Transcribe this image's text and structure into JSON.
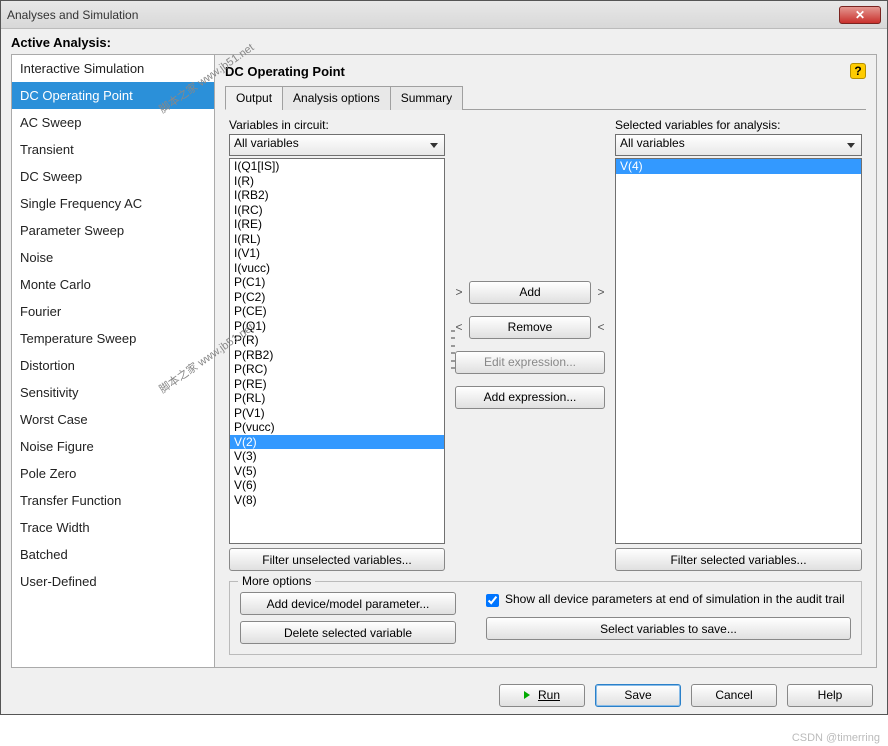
{
  "window": {
    "title": "Analyses and Simulation",
    "close": "✕"
  },
  "header": "Active Analysis:",
  "sidebar": {
    "items": [
      "Interactive Simulation",
      "DC Operating Point",
      "AC Sweep",
      "Transient",
      "DC Sweep",
      "Single Frequency AC",
      "Parameter Sweep",
      "Noise",
      "Monte Carlo",
      "Fourier",
      "Temperature Sweep",
      "Distortion",
      "Sensitivity",
      "Worst Case",
      "Noise Figure",
      "Pole Zero",
      "Transfer Function",
      "Trace Width",
      "Batched",
      "User-Defined"
    ],
    "selected_index": 1
  },
  "main": {
    "title": "DC Operating Point",
    "help": "?",
    "tabs": [
      "Output",
      "Analysis options",
      "Summary"
    ],
    "active_tab": 0,
    "left": {
      "label": "Variables in circuit:",
      "combo": "All variables",
      "items": [
        "I(Q1[IS])",
        "I(R)",
        "I(RB2)",
        "I(RC)",
        "I(RE)",
        "I(RL)",
        "I(V1)",
        "I(vucc)",
        "P(C1)",
        "P(C2)",
        "P(CE)",
        "P(Q1)",
        "P(R)",
        "P(RB2)",
        "P(RC)",
        "P(RE)",
        "P(RL)",
        "P(V1)",
        "P(vucc)",
        "V(2)",
        "V(3)",
        "V(5)",
        "V(6)",
        "V(8)"
      ],
      "selected_index": 19,
      "filter": "Filter unselected variables..."
    },
    "middle": {
      "add": "Add",
      "remove": "Remove",
      "edit": "Edit expression...",
      "addexpr": "Add expression..."
    },
    "right": {
      "label": "Selected variables for analysis:",
      "combo": "All variables",
      "items": [
        "V(4)"
      ],
      "selected_index": 0,
      "filter": "Filter selected variables..."
    },
    "more": {
      "legend": "More options",
      "add_param": "Add device/model parameter...",
      "del_var": "Delete selected variable",
      "show_all": "Show all device parameters at end of simulation in the audit trail",
      "select_save": "Select variables to save..."
    }
  },
  "footer": {
    "run": "Run",
    "save": "Save",
    "cancel": "Cancel",
    "help": "Help"
  },
  "watermark": "脚本之家 www.jb51.net",
  "csdn": "CSDN @timerring"
}
